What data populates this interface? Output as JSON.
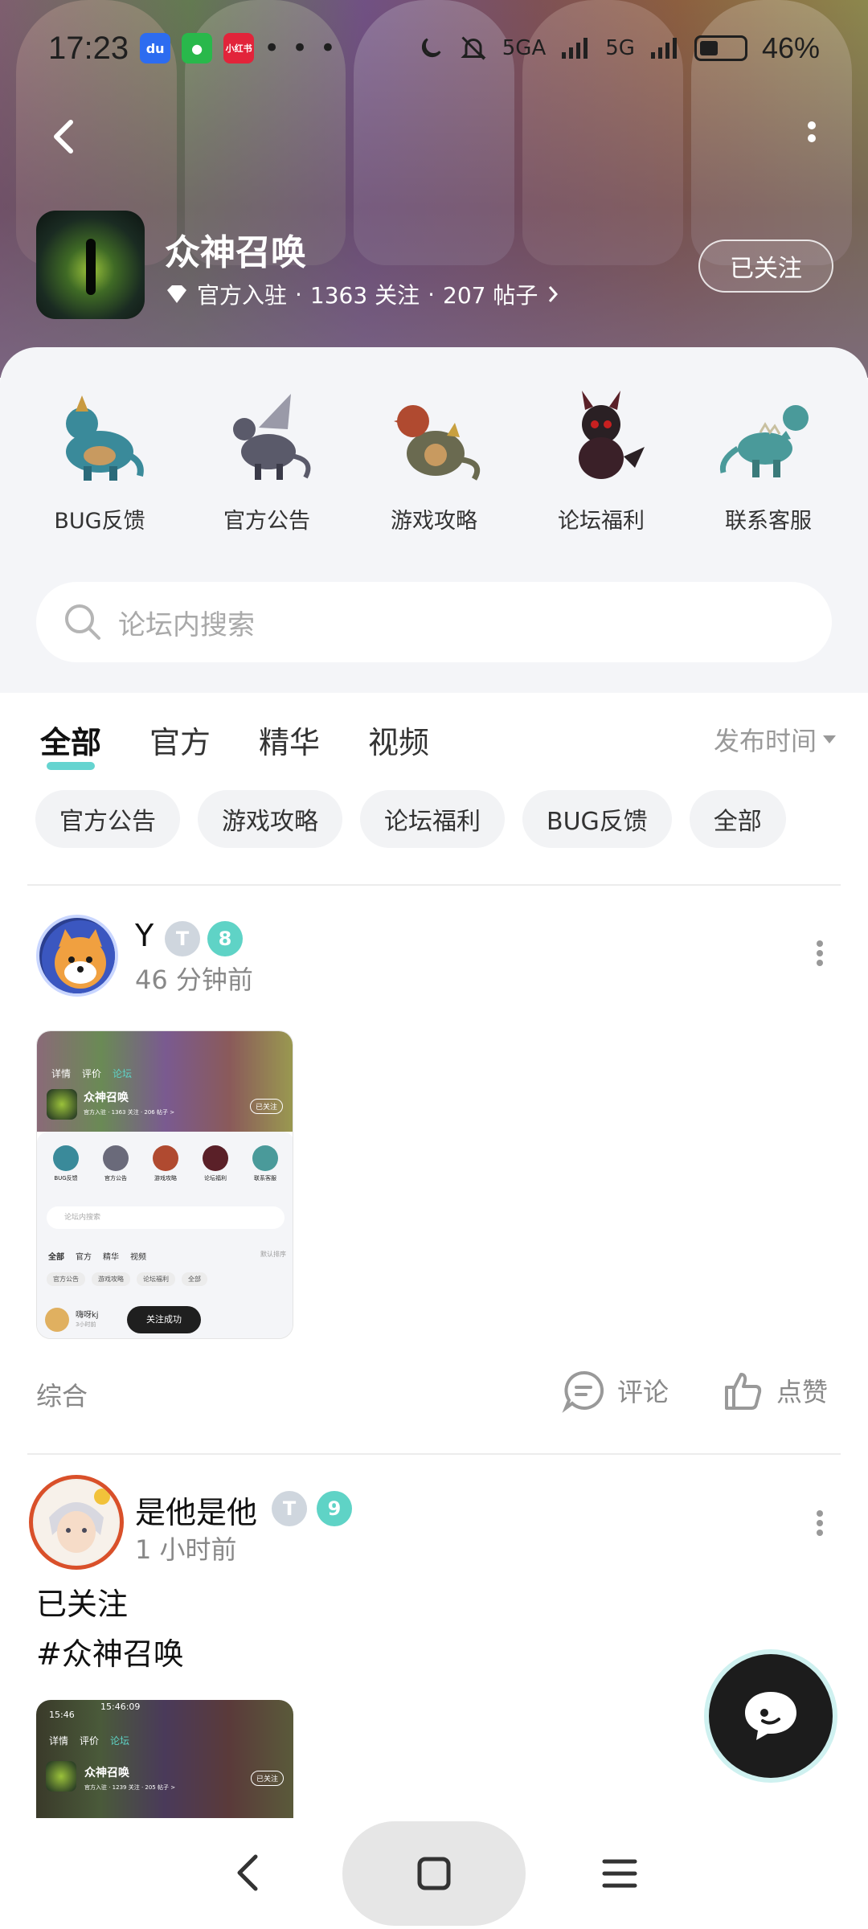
{
  "status_bar": {
    "time": "17:23",
    "apps": [
      {
        "name": "baidu-icon",
        "color": "#2d6cf0",
        "glyph": "du"
      },
      {
        "name": "wechat-icon",
        "color": "#29b84b",
        "glyph": "●"
      },
      {
        "name": "xiaohongshu-icon",
        "color": "#e2243a",
        "glyph": "小红书"
      }
    ],
    "more": "• • •",
    "network_1": "5GA",
    "network_2": "5G",
    "battery": "46%"
  },
  "forum": {
    "name": "众神召唤",
    "meta": {
      "official": "官方入驻",
      "followers": "1363 关注",
      "separator": "·",
      "posts": "207 帖子"
    },
    "follow_button": "已关注"
  },
  "categories": [
    {
      "label": "BUG反馈",
      "icon": "blue-dragon-icon",
      "color": "#3a8a9a"
    },
    {
      "label": "官方公告",
      "icon": "winged-dragon-icon",
      "color": "#6a6a7a"
    },
    {
      "label": "游戏攻略",
      "icon": "red-dragon-icon",
      "color": "#b04a30"
    },
    {
      "label": "论坛福利",
      "icon": "dark-dragon-icon",
      "color": "#5a2028"
    },
    {
      "label": "联系客服",
      "icon": "teal-dragon-icon",
      "color": "#4a9a9a"
    }
  ],
  "search": {
    "placeholder": "论坛内搜索"
  },
  "tabs": [
    {
      "label": "全部",
      "active": true
    },
    {
      "label": "官方",
      "active": false
    },
    {
      "label": "精华",
      "active": false
    },
    {
      "label": "视频",
      "active": false
    }
  ],
  "sort": {
    "label": "发布时间"
  },
  "chips": [
    "官方公告",
    "游戏攻略",
    "论坛福利",
    "BUG反馈",
    "全部"
  ],
  "posts": [
    {
      "user": "Y",
      "badge_t": "T",
      "level": "8",
      "time": "46 分钟前",
      "thumbnail": {
        "forum_name": "众神召唤",
        "meta": "官方入驻 · 1363 关注 · 206 帖子 >",
        "follow": "已关注",
        "tabs": [
          "详情",
          "评价",
          "论坛"
        ],
        "cats": [
          "BUG反馈",
          "官方公告",
          "游戏攻略",
          "论坛福利",
          "联系客服"
        ],
        "search": "论坛内搜索",
        "filters": [
          "全部",
          "官方",
          "精华",
          "视频"
        ],
        "sort": "默认排序",
        "chips": [
          "官方公告",
          "游戏攻略",
          "论坛福利",
          "全部"
        ],
        "user": "嗨呀kj",
        "toast": "关注成功",
        "time": "3小时前"
      },
      "tag": "综合",
      "comment": "评论",
      "like": "点赞"
    },
    {
      "user": "是他是他",
      "badge_t": "T",
      "level": "9",
      "time": "1 小时前",
      "text_1": "已关注",
      "text_2": "#众神召唤",
      "thumbnail": {
        "time_left": "15:46",
        "time_center": "15:46:09",
        "tabs": [
          "详情",
          "评价",
          "论坛"
        ],
        "forum_name": "众神召唤",
        "meta": "官方入驻 · 1239 关注 · 205 帖子 >",
        "follow": "已关注"
      }
    }
  ],
  "colors": {
    "accent": "#3ec9c4",
    "level_badge": "#5fd3c6",
    "card_bg": "#f4f5f8"
  }
}
